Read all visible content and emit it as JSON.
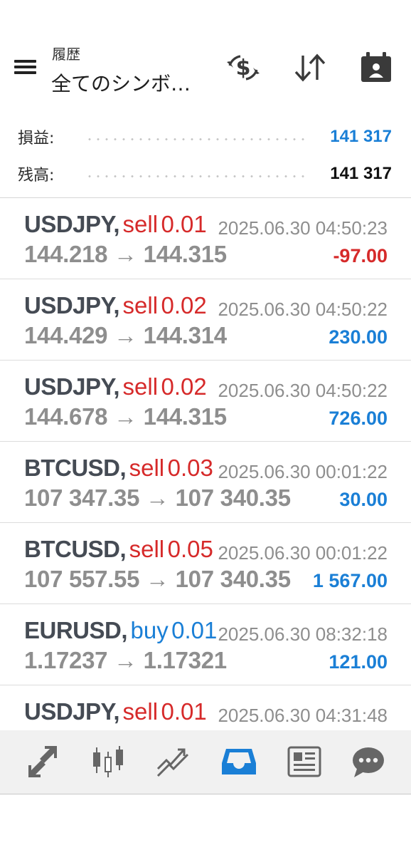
{
  "header": {
    "subtitle": "履歴",
    "title": "全てのシンボ…",
    "icons": [
      "menu-icon",
      "currency-exchange-icon",
      "sort-icon",
      "calendar-icon"
    ]
  },
  "summary": {
    "profit": {
      "label": "損益:",
      "value": "141 317",
      "color": "#1a7fd6"
    },
    "balance": {
      "label": "残高:",
      "value": "141 317",
      "color": "#111111"
    }
  },
  "trades": [
    {
      "symbol": "USDJPY,",
      "side": "sell",
      "volume": "0.01",
      "time": "2025.06.30 04:50:23",
      "open_price": "144.218",
      "arrow": "→",
      "close_price": "144.315",
      "profit": "-97.00",
      "profit_sign": "neg"
    },
    {
      "symbol": "USDJPY,",
      "side": "sell",
      "volume": "0.02",
      "time": "2025.06.30 04:50:22",
      "open_price": "144.429",
      "arrow": "→",
      "close_price": "144.314",
      "profit": "230.00",
      "profit_sign": "pos"
    },
    {
      "symbol": "USDJPY,",
      "side": "sell",
      "volume": "0.02",
      "time": "2025.06.30 04:50:22",
      "open_price": "144.678",
      "arrow": "→",
      "close_price": "144.315",
      "profit": "726.00",
      "profit_sign": "pos"
    },
    {
      "symbol": "BTCUSD,",
      "side": "sell",
      "volume": "0.03",
      "time": "2025.06.30 00:01:22",
      "open_price": "107 347.35",
      "arrow": "→",
      "close_price": "107 340.35",
      "profit": "30.00",
      "profit_sign": "pos"
    },
    {
      "symbol": "BTCUSD,",
      "side": "sell",
      "volume": "0.05",
      "time": "2025.06.30 00:01:22",
      "open_price": "107 557.55",
      "arrow": "→",
      "close_price": "107 340.35",
      "profit": "1 567.00",
      "profit_sign": "pos"
    },
    {
      "symbol": "EURUSD,",
      "side": "buy",
      "volume": "0.01",
      "time": "2025.06.30 08:32:18",
      "open_price": "1.17237",
      "arrow": "→",
      "close_price": "1.17321",
      "profit": "121.00",
      "profit_sign": "pos"
    },
    {
      "symbol": "USDJPY,",
      "side": "sell",
      "volume": "0.01",
      "time": "2025.06.30 04:31:48",
      "open_price": "",
      "arrow": "",
      "close_price": "",
      "profit": "",
      "profit_sign": "pos"
    }
  ],
  "tabbar": {
    "items": [
      {
        "icon": "quotes-icon",
        "active": false
      },
      {
        "icon": "chart-icon",
        "active": false
      },
      {
        "icon": "trade-icon",
        "active": false
      },
      {
        "icon": "history-icon",
        "active": true
      },
      {
        "icon": "news-icon",
        "active": false
      },
      {
        "icon": "messages-icon",
        "active": false
      }
    ],
    "active_color": "#1a7fd6",
    "inactive_color": "#666666"
  }
}
